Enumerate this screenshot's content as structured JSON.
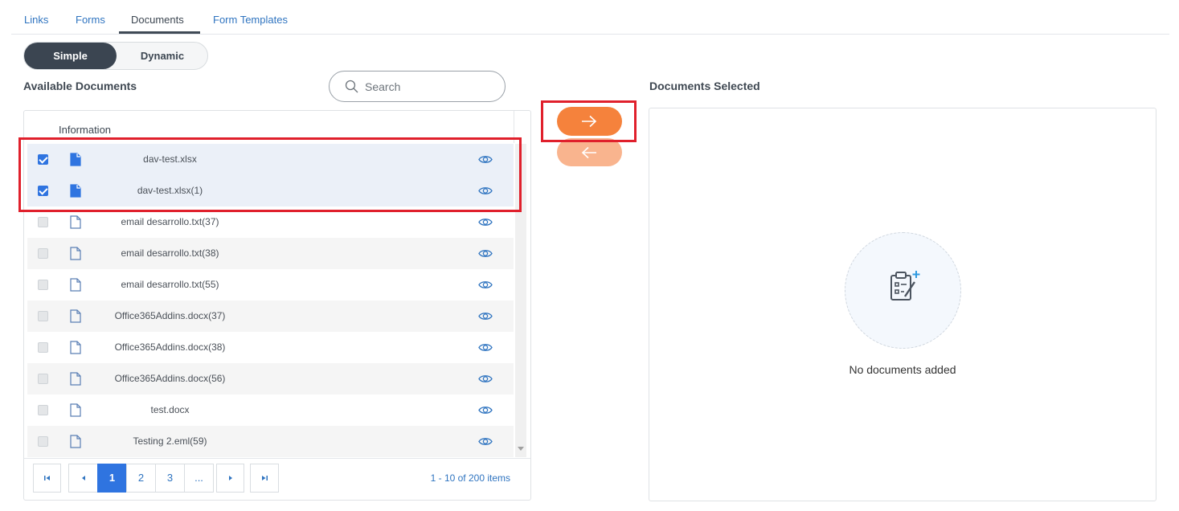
{
  "tabs": [
    {
      "label": "Links",
      "active": false
    },
    {
      "label": "Forms",
      "active": false
    },
    {
      "label": "Documents",
      "active": true
    },
    {
      "label": "Form Templates",
      "active": false
    }
  ],
  "mode_toggle": {
    "simple": "Simple",
    "dynamic": "Dynamic",
    "selected": "Simple"
  },
  "available": {
    "title": "Available Documents",
    "search_placeholder": "Search",
    "column_header": "Information",
    "rows": [
      {
        "name": "dav-test.xlsx",
        "checked": true
      },
      {
        "name": "dav-test.xlsx(1)",
        "checked": true
      },
      {
        "name": "email desarrollo.txt(37)",
        "checked": false
      },
      {
        "name": "email desarrollo.txt(38)",
        "checked": false
      },
      {
        "name": "email desarrollo.txt(55)",
        "checked": false
      },
      {
        "name": "Office365Addins.docx(37)",
        "checked": false
      },
      {
        "name": "Office365Addins.docx(38)",
        "checked": false
      },
      {
        "name": "Office365Addins.docx(56)",
        "checked": false
      },
      {
        "name": "test.docx",
        "checked": false
      },
      {
        "name": "Testing 2.eml(59)",
        "checked": false
      }
    ],
    "pager": {
      "pages": [
        "1",
        "2",
        "3",
        "..."
      ],
      "current_page": "1",
      "info": "1 - 10 of 200 items"
    }
  },
  "selected": {
    "title": "Documents Selected",
    "empty_message": "No documents added"
  },
  "colors": {
    "accent_blue": "#2f74e0",
    "move_right": "#f5823c",
    "move_left": "#f9b48e",
    "highlight": "#e0202c"
  },
  "icons": {
    "search": "search-icon",
    "file": "file-icon",
    "preview": "eye-icon",
    "move_right": "arrow-right-icon",
    "move_left": "arrow-left-icon",
    "empty": "clipboard-add-icon"
  }
}
